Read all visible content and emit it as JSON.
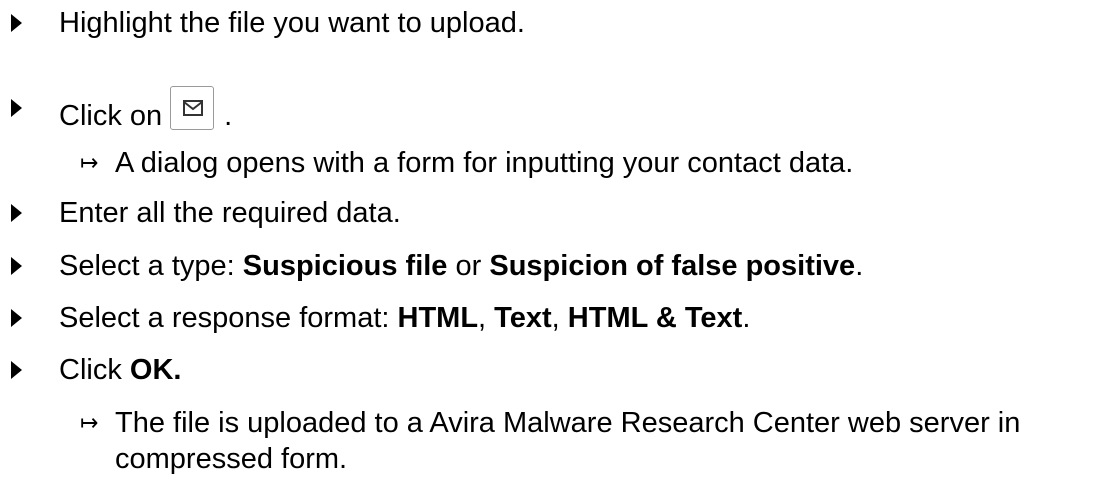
{
  "steps": [
    {
      "type": "action",
      "text": "Highlight the file you want to upload."
    },
    {
      "type": "action",
      "prefix": "Click on",
      "suffix": ".",
      "icon": "mail-icon"
    },
    {
      "type": "result",
      "text": "A dialog opens with a form for inputting your contact data."
    },
    {
      "type": "action",
      "text": "Enter all the required data."
    },
    {
      "type": "action",
      "prefix": "Select a type:",
      "option1": "Suspicious file",
      "or": "or",
      "option2": "Suspicion of false positive",
      "suffix": "."
    },
    {
      "type": "action",
      "prefix": "Select a response format:",
      "format1": "HTML",
      "sep1": ",",
      "format2": "Text",
      "sep2": ",",
      "format3": "HTML & Text",
      "suffix": "."
    },
    {
      "type": "action",
      "prefix": "Click",
      "bold": "OK."
    },
    {
      "type": "result",
      "line1": "The file is uploaded to a Avira Malware Research Center web server in",
      "line2": "compressed form."
    }
  ],
  "result_arrow": "↦",
  "colors": {
    "text": "#000000",
    "button_border": "#9a9a9a",
    "icon_stroke": "#333333"
  }
}
